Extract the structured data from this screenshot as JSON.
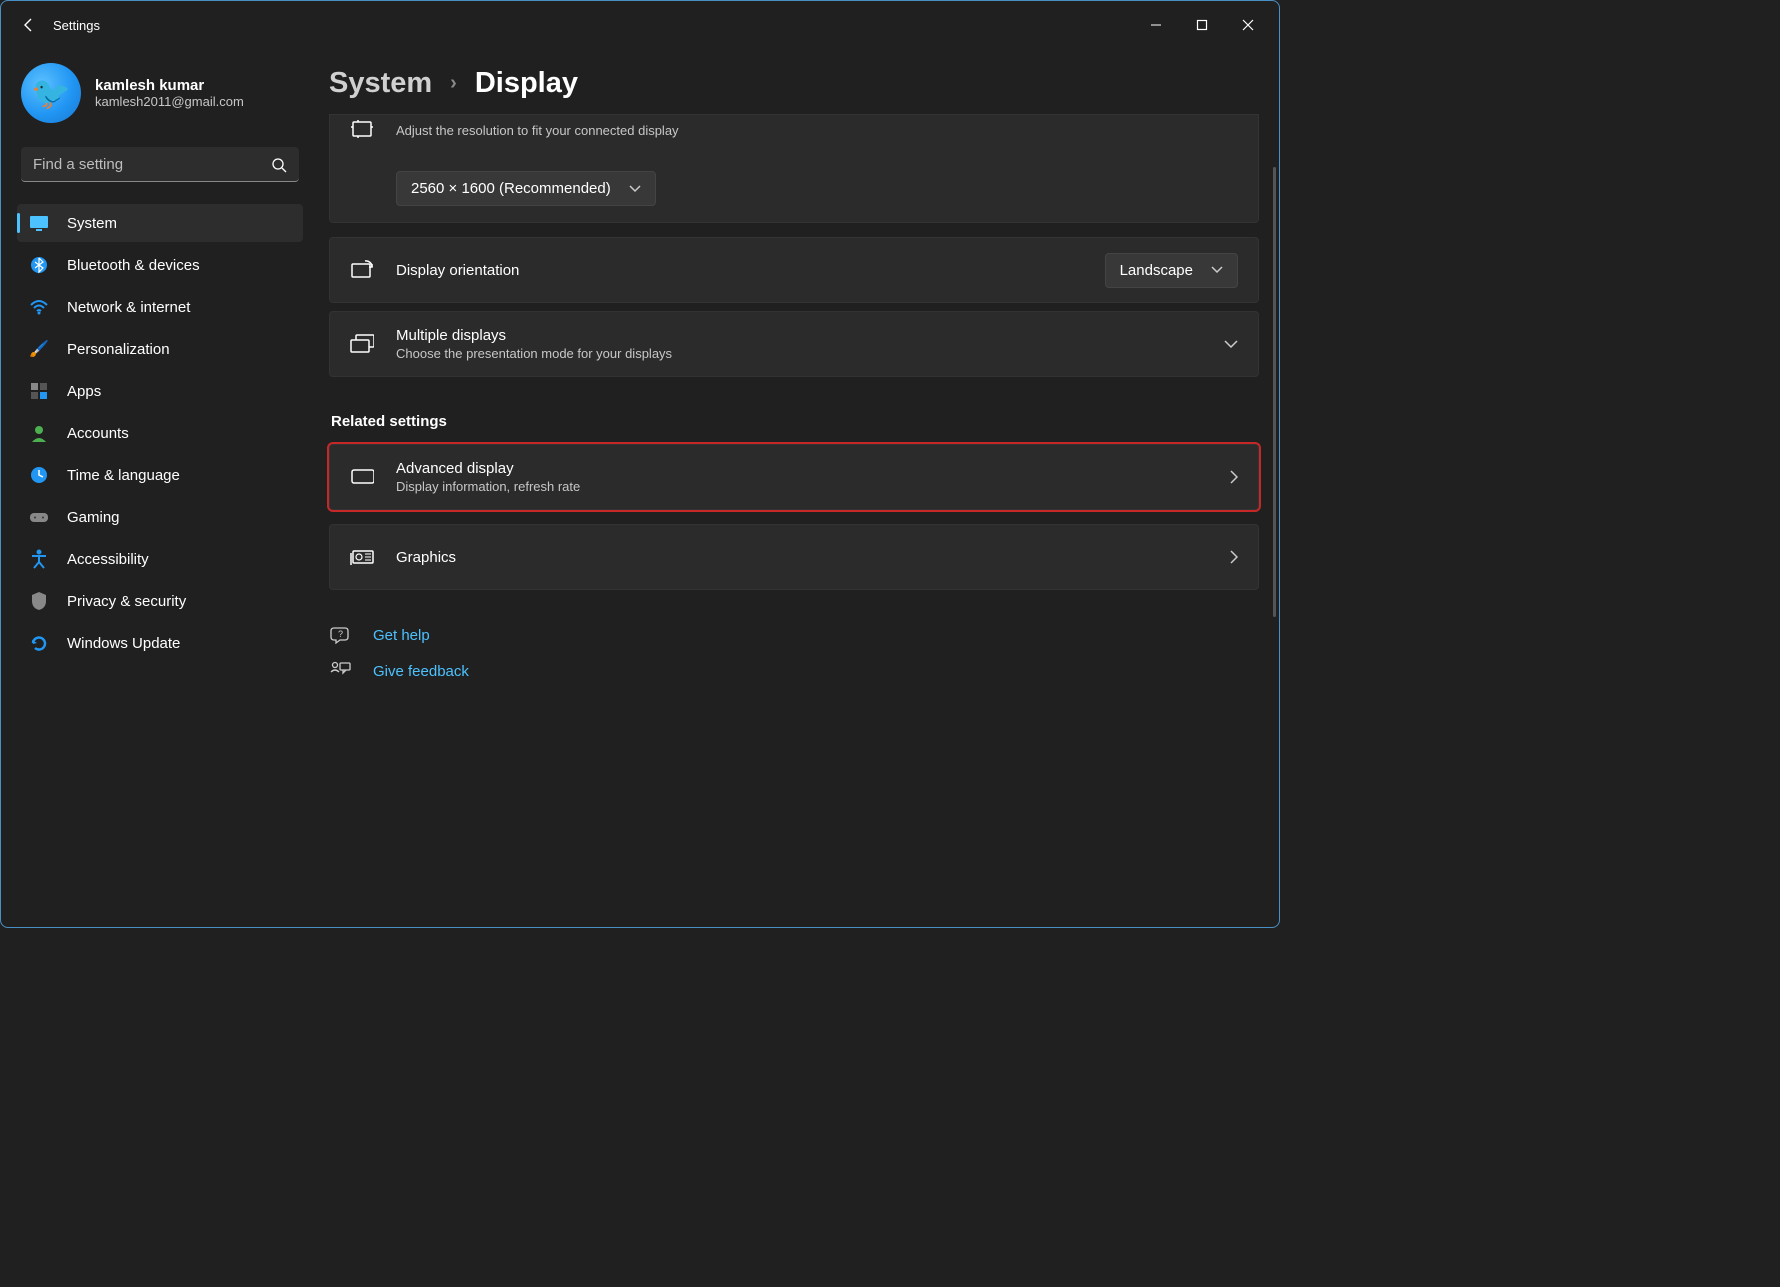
{
  "window": {
    "title": "Settings"
  },
  "profile": {
    "name": "kamlesh kumar",
    "email": "kamlesh2011@gmail.com"
  },
  "search": {
    "placeholder": "Find a setting"
  },
  "nav": [
    {
      "label": "System",
      "icon": "🖥️",
      "active": true
    },
    {
      "label": "Bluetooth & devices",
      "icon": "bt"
    },
    {
      "label": "Network & internet",
      "icon": "wifi"
    },
    {
      "label": "Personalization",
      "icon": "🖌️"
    },
    {
      "label": "Apps",
      "icon": "apps"
    },
    {
      "label": "Accounts",
      "icon": "👤"
    },
    {
      "label": "Time & language",
      "icon": "🕐"
    },
    {
      "label": "Gaming",
      "icon": "🎮"
    },
    {
      "label": "Accessibility",
      "icon": "acc"
    },
    {
      "label": "Privacy & security",
      "icon": "🛡️"
    },
    {
      "label": "Windows Update",
      "icon": "🔄"
    }
  ],
  "breadcrumb": {
    "parent": "System",
    "current": "Display"
  },
  "resolution": {
    "subtitle": "Adjust the resolution to fit your connected display",
    "value": "2560 × 1600 (Recommended)"
  },
  "orientation": {
    "title": "Display orientation",
    "value": "Landscape"
  },
  "multiple": {
    "title": "Multiple displays",
    "subtitle": "Choose the presentation mode for your displays"
  },
  "related_title": "Related settings",
  "advanced": {
    "title": "Advanced display",
    "subtitle": "Display information, refresh rate"
  },
  "graphics": {
    "title": "Graphics"
  },
  "help": {
    "label": "Get help"
  },
  "feedback": {
    "label": "Give feedback"
  }
}
